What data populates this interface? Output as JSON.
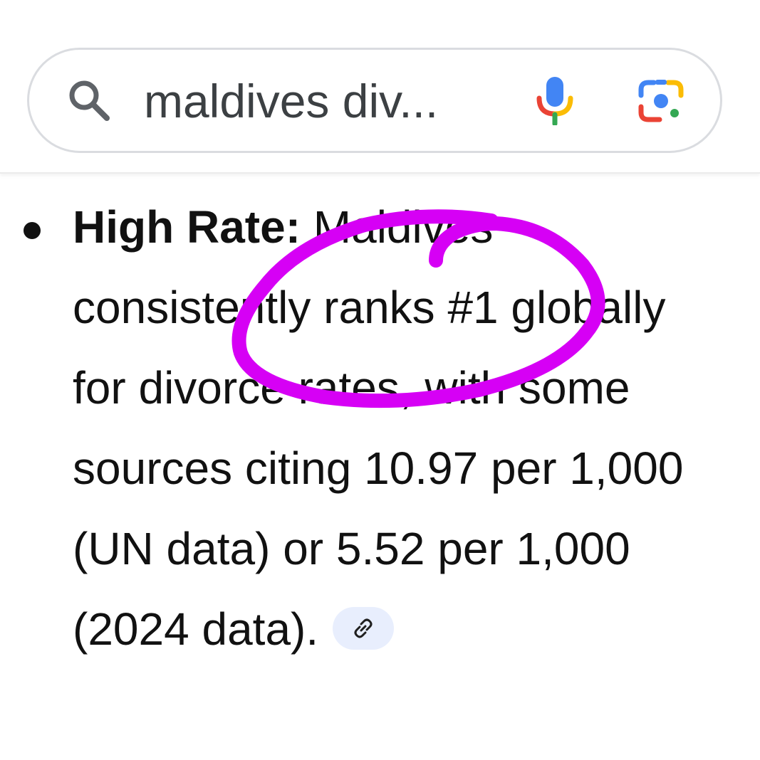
{
  "search": {
    "query": "maldives div...",
    "icons": [
      "search-icon",
      "microphone-icon",
      "google-lens-icon"
    ]
  },
  "answer": {
    "heading": "High Rate:",
    "body": " Maldives consistently ranks #1 globally for divorce rates, with some sources citing 10.97 per 1,000 (UN data) or 5.52 per 1,000 (2024 data).",
    "link_icon": "link-icon"
  },
  "annotation": {
    "color": "#d600f5",
    "shape": "hand-drawn-circle"
  }
}
